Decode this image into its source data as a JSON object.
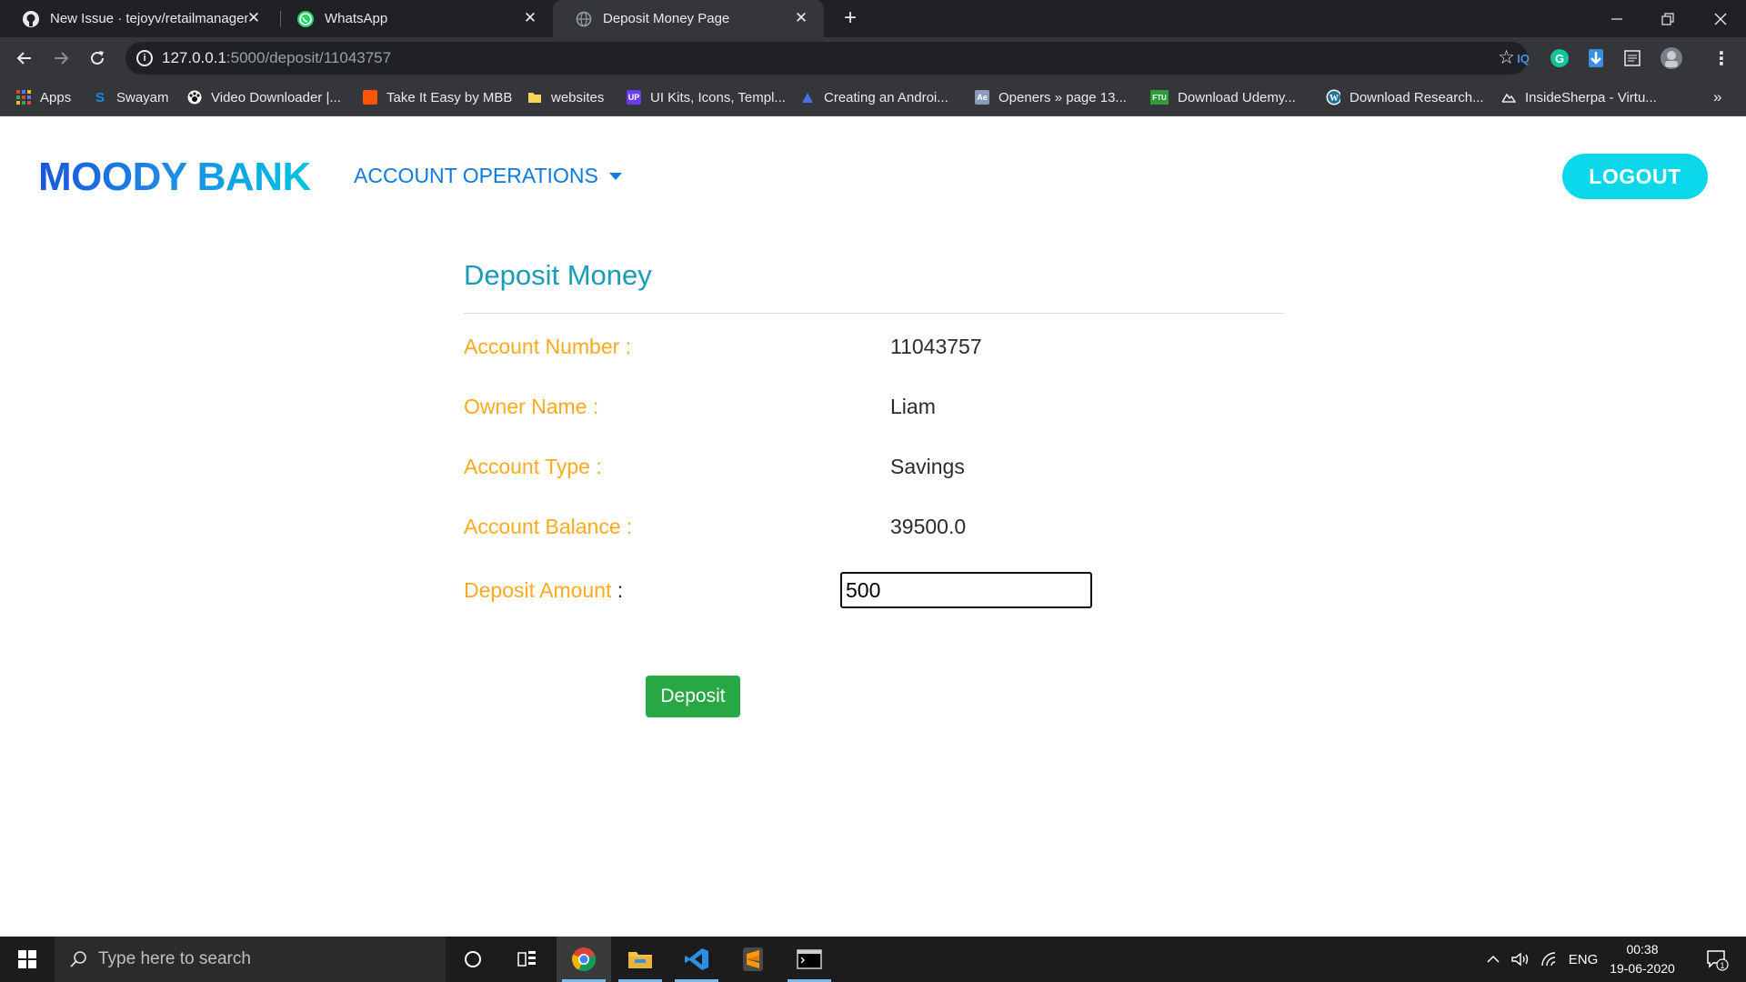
{
  "browser": {
    "tabs": [
      {
        "title": "New Issue · tejoyv/retailmanagem",
        "favicon": "github-icon"
      },
      {
        "title": "WhatsApp",
        "favicon": "whatsapp-icon"
      },
      {
        "title": "Deposit Money Page",
        "favicon": "globe-icon",
        "active": true
      }
    ],
    "url_host": "127.0.0.1",
    "url_path": ":5000/deposit/11043757",
    "bookmarks": [
      "Apps",
      "Swayam",
      "Video Downloader |...",
      "Take It Easy by MBB",
      "websites",
      "UI Kits, Icons, Templ...",
      "Creating an Androi...",
      "Openers » page 13...",
      "Download Udemy...",
      "Download Research...",
      "InsideSherpa - Virtu..."
    ],
    "bookmarks_overflow": "»",
    "extensions": {
      "iq": "IQ",
      "grammarly": "G"
    }
  },
  "navbar": {
    "brand": "MOODY BANK",
    "menu": "ACCOUNT OPERATIONS",
    "logout": "LOGOUT"
  },
  "deposit": {
    "heading": "Deposit Money",
    "fields": [
      {
        "label": "Account Number :",
        "value": "11043757"
      },
      {
        "label": "Owner Name :",
        "value": "Liam"
      },
      {
        "label": "Account Type :",
        "value": "Savings"
      },
      {
        "label": "Account Balance :",
        "value": "39500.0"
      }
    ],
    "amount_label": "Deposit Amount",
    "amount_colon": ":",
    "amount_value": "500",
    "button": "Deposit"
  },
  "taskbar": {
    "search_placeholder": "Type here to search",
    "language": "ENG",
    "time": "00:38",
    "date": "19-06-2020",
    "notification_count": "1"
  },
  "colors": {
    "brand_gradient_start": "#1a56db",
    "brand_gradient_end": "#03c3e3",
    "label_orange": "#ffa91f",
    "heading_teal": "#1a9bb6",
    "deposit_green": "#28a745",
    "logout_cyan": "#0bd7ea"
  }
}
